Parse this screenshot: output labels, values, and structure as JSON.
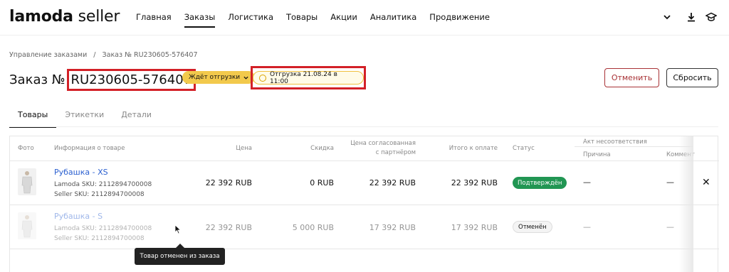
{
  "header": {
    "logo_main": "lamoda",
    "logo_sub": "seller",
    "nav": [
      "Главная",
      "Заказы",
      "Логистика",
      "Товары",
      "Акции",
      "Аналитика",
      "Продвижение"
    ],
    "active_nav": "Заказы",
    "icons": [
      "chevron-down-icon",
      "download-icon",
      "graduation-cap-icon"
    ]
  },
  "breadcrumb": {
    "parent": "Управление заказами",
    "separator": "/",
    "current": "Заказ № RU230605-576407"
  },
  "order": {
    "title_prefix": "Заказ №",
    "number": "RU230605-576407",
    "status_badge": "Ждёт отгрузки",
    "shipment": "Отгрузка 21.08.24 в 11:00"
  },
  "buttons": {
    "cancel": "Отменить",
    "reset": "Сбросить"
  },
  "tabs": [
    {
      "label": "Товары",
      "active": true
    },
    {
      "label": "Этикетки",
      "active": false
    },
    {
      "label": "Детали",
      "active": false
    }
  ],
  "table": {
    "columns": {
      "photo": "Фото",
      "info": "Информация о товаре",
      "price": "Цена",
      "discount": "Скидка",
      "agreed_price_1": "Цена согласованная",
      "agreed_price_2": "с партнёром",
      "total": "Итого к оплате",
      "status": "Статус",
      "act": "Акт несоответствия",
      "reason": "Причина",
      "comment": "Коммент"
    },
    "rows": [
      {
        "name": "Рубашка - XS",
        "lamoda_sku": "Lamoda SKU: 2112894700008",
        "seller_sku": "Seller SKU: 2112894700008",
        "price": "22 392 RUB",
        "discount": "0 RUB",
        "agreed": "22 392 RUB",
        "total": "22 392 RUB",
        "status": "Подтверждён",
        "reason": "—",
        "comment": "—",
        "close": "✕"
      },
      {
        "name": "Рубашка - S",
        "lamoda_sku": "Lamoda SKU: 2112894700008",
        "seller_sku": "Seller SKU: 2112894700008",
        "price": "22 392 RUB",
        "discount": "5 000 RUB",
        "agreed": "17 392 RUB",
        "total": "17 392 RUB",
        "status": "Отменён",
        "reason": "—",
        "comment": "—"
      }
    ]
  },
  "tooltip": "Товар отменен из заказа",
  "colors": {
    "highlight_box": "#d32027",
    "status_yellow": "#f2c94c",
    "status_green": "#219653",
    "link": "#2a5fd0",
    "cancel_button": "#a83236"
  }
}
